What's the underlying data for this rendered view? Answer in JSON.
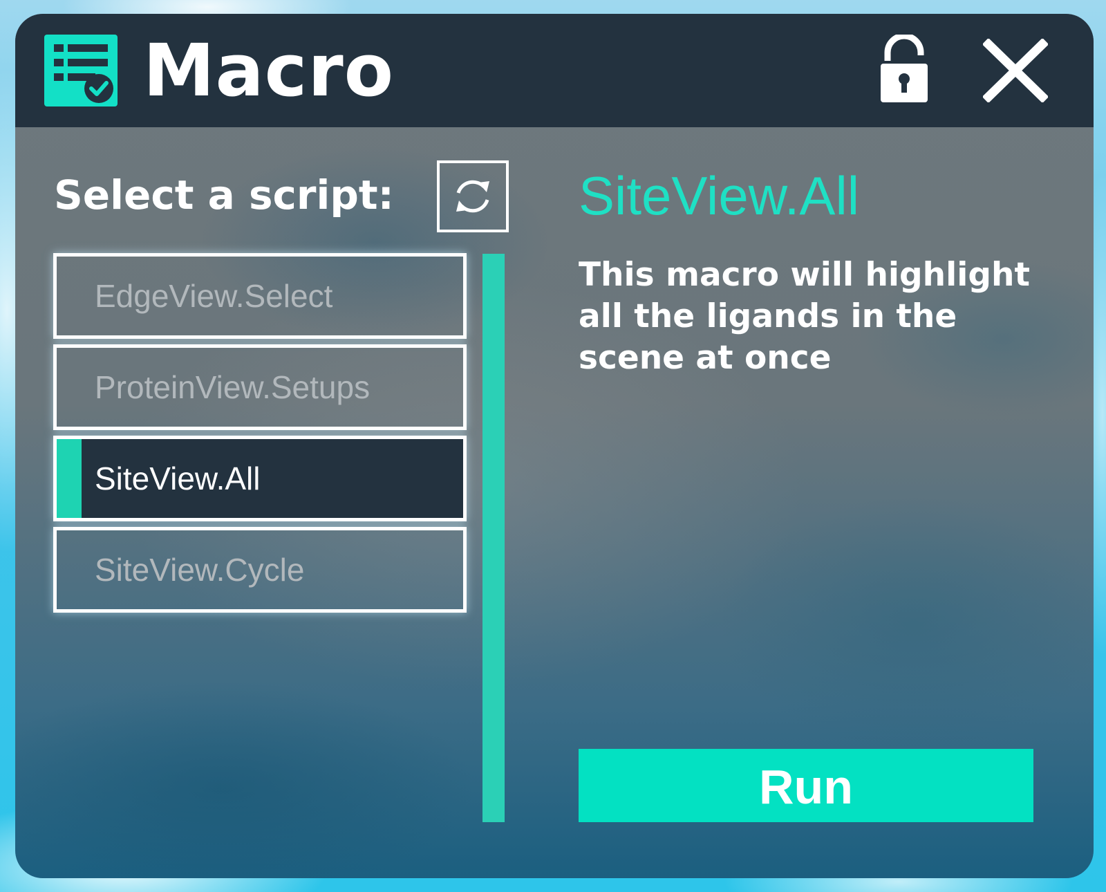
{
  "window": {
    "title": "Macro",
    "icons": {
      "app": "macro-checklist-icon",
      "lock": "unlocked-padlock-icon",
      "close": "close-icon",
      "refresh": "refresh-icon"
    }
  },
  "sidebar": {
    "select_label": "Select a script:",
    "items": [
      {
        "label": "EdgeView.Select",
        "selected": false
      },
      {
        "label": "ProteinView.Setups",
        "selected": false
      },
      {
        "label": "SiteView.All",
        "selected": true
      },
      {
        "label": "SiteView.Cycle",
        "selected": false
      }
    ]
  },
  "detail": {
    "title": "SiteView.All",
    "description": "This macro will highlight all the ligands in the scene at once",
    "run_label": "Run"
  },
  "colors": {
    "accent": "#1ed3b2",
    "run_button": "#03e1c2",
    "titlebar": "#23323f",
    "selected_item": "#23323f",
    "detail_title": "#1fe0c4"
  }
}
